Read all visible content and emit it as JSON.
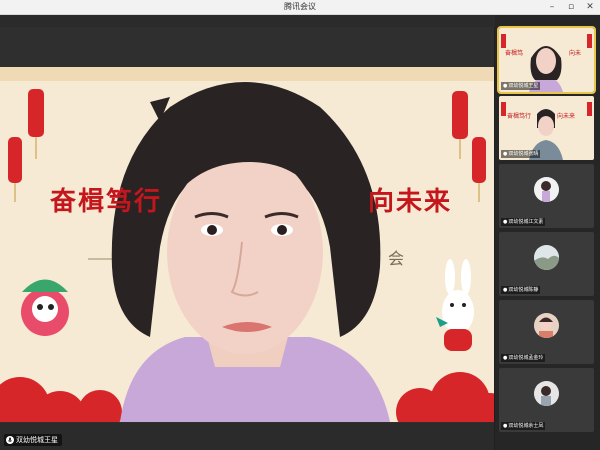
{
  "window": {
    "title": "腾讯会议"
  },
  "main": {
    "banner_left": "奋楫笃行",
    "banner_right": "向未来",
    "banner_sub": "会",
    "speaker_name": "双幼悦城王星"
  },
  "participants": [
    {
      "name": "双幼悦城王星"
    },
    {
      "name": "双幼悦城张晴"
    },
    {
      "name": "双幼悦城江文素"
    },
    {
      "name": "双幼悦城陈静"
    },
    {
      "name": "双幼悦城孟金玲"
    },
    {
      "name": "双幼悦城余士凤"
    }
  ],
  "colors": {
    "accent": "#e8c547",
    "banner_red": "#c4161c"
  }
}
